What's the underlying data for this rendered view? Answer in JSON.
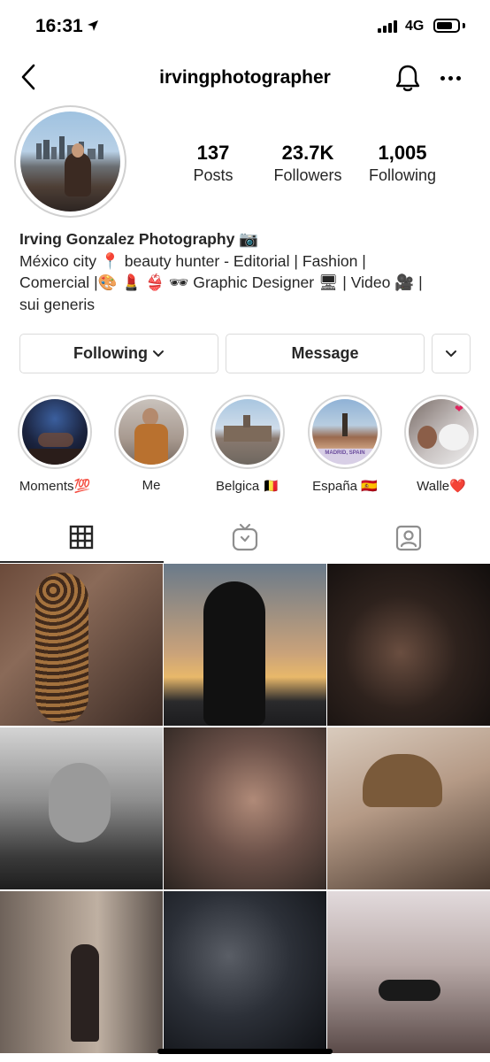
{
  "status_bar": {
    "time": "16:31",
    "network": "4G"
  },
  "header": {
    "username": "irvingphotographer"
  },
  "profile": {
    "stats": [
      {
        "value": "137",
        "label": "Posts"
      },
      {
        "value": "23.7K",
        "label": "Followers"
      },
      {
        "value": "1,005",
        "label": "Following"
      }
    ],
    "bio": {
      "name": "Irving Gonzalez Photography 📷",
      "lines": [
        "México city 📍 beauty hunter - Editorial | Fashion |",
        "Comercial |🎨 💄 👙 🕶 Graphic Designer 🖥 | Video 🎥 |",
        "sui generis"
      ]
    }
  },
  "actions": {
    "following_label": "Following",
    "message_label": "Message"
  },
  "highlights": [
    {
      "label": "Moments💯"
    },
    {
      "label": "Me"
    },
    {
      "label": "Belgica 🇧🇪"
    },
    {
      "label": "España 🇪🇸",
      "badge": "MADRID, SPAIN"
    },
    {
      "label": "Walle❤️"
    }
  ],
  "tabs": [
    "grid-icon",
    "igtv-icon",
    "tagged-icon"
  ],
  "grid_posts": [
    {
      "name": "post-leopard-dress",
      "colors": [
        "#6b4a3a",
        "#3a2a24"
      ]
    },
    {
      "name": "post-silhouette-sunset",
      "colors": [
        "#e8b86a",
        "#1c1c1e"
      ]
    },
    {
      "name": "post-portrait-shadow",
      "colors": [
        "#4a3a32",
        "#120e0d"
      ]
    },
    {
      "name": "post-water-bw",
      "colors": [
        "#bdbdbd",
        "#2a2a2a"
      ]
    },
    {
      "name": "post-glitter-makeup",
      "colors": [
        "#8a6a5c",
        "#2b2420"
      ]
    },
    {
      "name": "post-smoking-man",
      "colors": [
        "#c9b6a4",
        "#4a3a30"
      ]
    },
    {
      "name": "post-city-street",
      "colors": [
        "#9a8a7a",
        "#2e2a28"
      ]
    },
    {
      "name": "post-dark-portrait",
      "colors": [
        "#2c3038",
        "#0e1014"
      ]
    },
    {
      "name": "post-choker-portrait",
      "colors": [
        "#cfc6c8",
        "#5a4a48"
      ]
    }
  ]
}
